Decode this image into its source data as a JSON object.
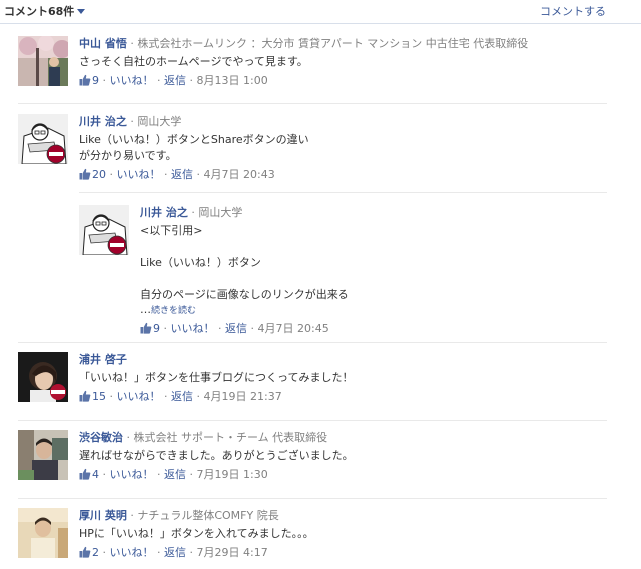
{
  "header": {
    "count_label": "コメント68件",
    "write_label": "コメントする"
  },
  "comments": [
    {
      "name": "中山 省悟",
      "affiliation": "株式会社ホームリンク ：大分市 賃貸アパート マンション 中古住宅 代表取締役",
      "text": "さっそく自社のホームページでやって見ます。",
      "likes": "9",
      "like_label": "いいね！",
      "reply_label": "返信",
      "time": "8月13日 1:00"
    },
    {
      "name": "川井 治之",
      "affiliation": "岡山大学",
      "text1": "Like（いいね！）ボタンとShareボタンの違い",
      "text2": "が分かり易いです。",
      "likes": "20",
      "like_label": "いいね！",
      "reply_label": "返信",
      "time": "4月7日 20:43"
    },
    {
      "name": "川井 治之",
      "affiliation": "岡山大学",
      "lines": [
        "<以下引用>",
        "Like（いいね！）ボタン",
        "自分のページに画像なしのリンクが出来る"
      ],
      "more_prefix": "…",
      "more_label": "続きを読む",
      "likes": "9",
      "like_label": "いいね！",
      "reply_label": "返信",
      "time": "4月7日 20:45"
    },
    {
      "name": "浦井 啓子",
      "text": "「いいね！」ボタンを仕事ブログにつくってみました！",
      "likes": "15",
      "like_label": "いいね！",
      "reply_label": "返信",
      "time": "4月19日 21:37"
    },
    {
      "name": "渋谷敏治",
      "affiliation": "株式会社 サポート・チーム 代表取締役",
      "text": "遅ればせながらできました。ありがとうございました。",
      "likes": "4",
      "like_label": "いいね！",
      "reply_label": "返信",
      "time": "7月19日 1:30"
    },
    {
      "name": "厚川 英明",
      "affiliation": "ナチュラル整体COMFY 院長",
      "text": "HPに「いいね！」ボタンを入れてみました。。。",
      "likes": "2",
      "like_label": "いいね！",
      "reply_label": "返信",
      "time": "7月29日 4:17"
    }
  ],
  "colors": {
    "link": "#3b5998",
    "meta": "#808080",
    "divider": "#e9e9e9"
  }
}
